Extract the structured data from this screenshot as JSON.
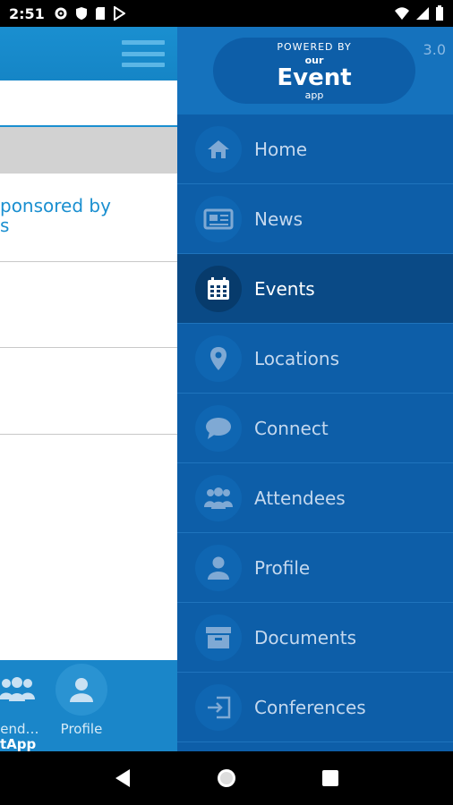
{
  "status_bar": {
    "time": "2:51"
  },
  "app": {
    "sponsored_line1": "ponsored by",
    "sponsored_line2": "s",
    "bottom": {
      "attendees_label": "tend…",
      "profile_label": "Profile",
      "brand_text": "tApp"
    }
  },
  "drawer": {
    "logo": {
      "powered": "POWERED BY",
      "our": "our",
      "event": "Event",
      "app": "app"
    },
    "version": "3.0",
    "items": [
      {
        "label": "Home",
        "icon": "home-icon"
      },
      {
        "label": "News",
        "icon": "newspaper-icon"
      },
      {
        "label": "Events",
        "icon": "calendar-icon"
      },
      {
        "label": "Locations",
        "icon": "location-pin-icon"
      },
      {
        "label": "Connect",
        "icon": "chat-bubble-icon"
      },
      {
        "label": "Attendees",
        "icon": "group-icon"
      },
      {
        "label": "Profile",
        "icon": "person-icon"
      },
      {
        "label": "Documents",
        "icon": "archive-box-icon"
      },
      {
        "label": "Conferences",
        "icon": "sign-in-icon"
      }
    ],
    "active_item": "Events"
  },
  "colors": {
    "drawer": "#0d5ea8",
    "active": "#0a4a86",
    "app_blue": "#1a8fd0"
  }
}
